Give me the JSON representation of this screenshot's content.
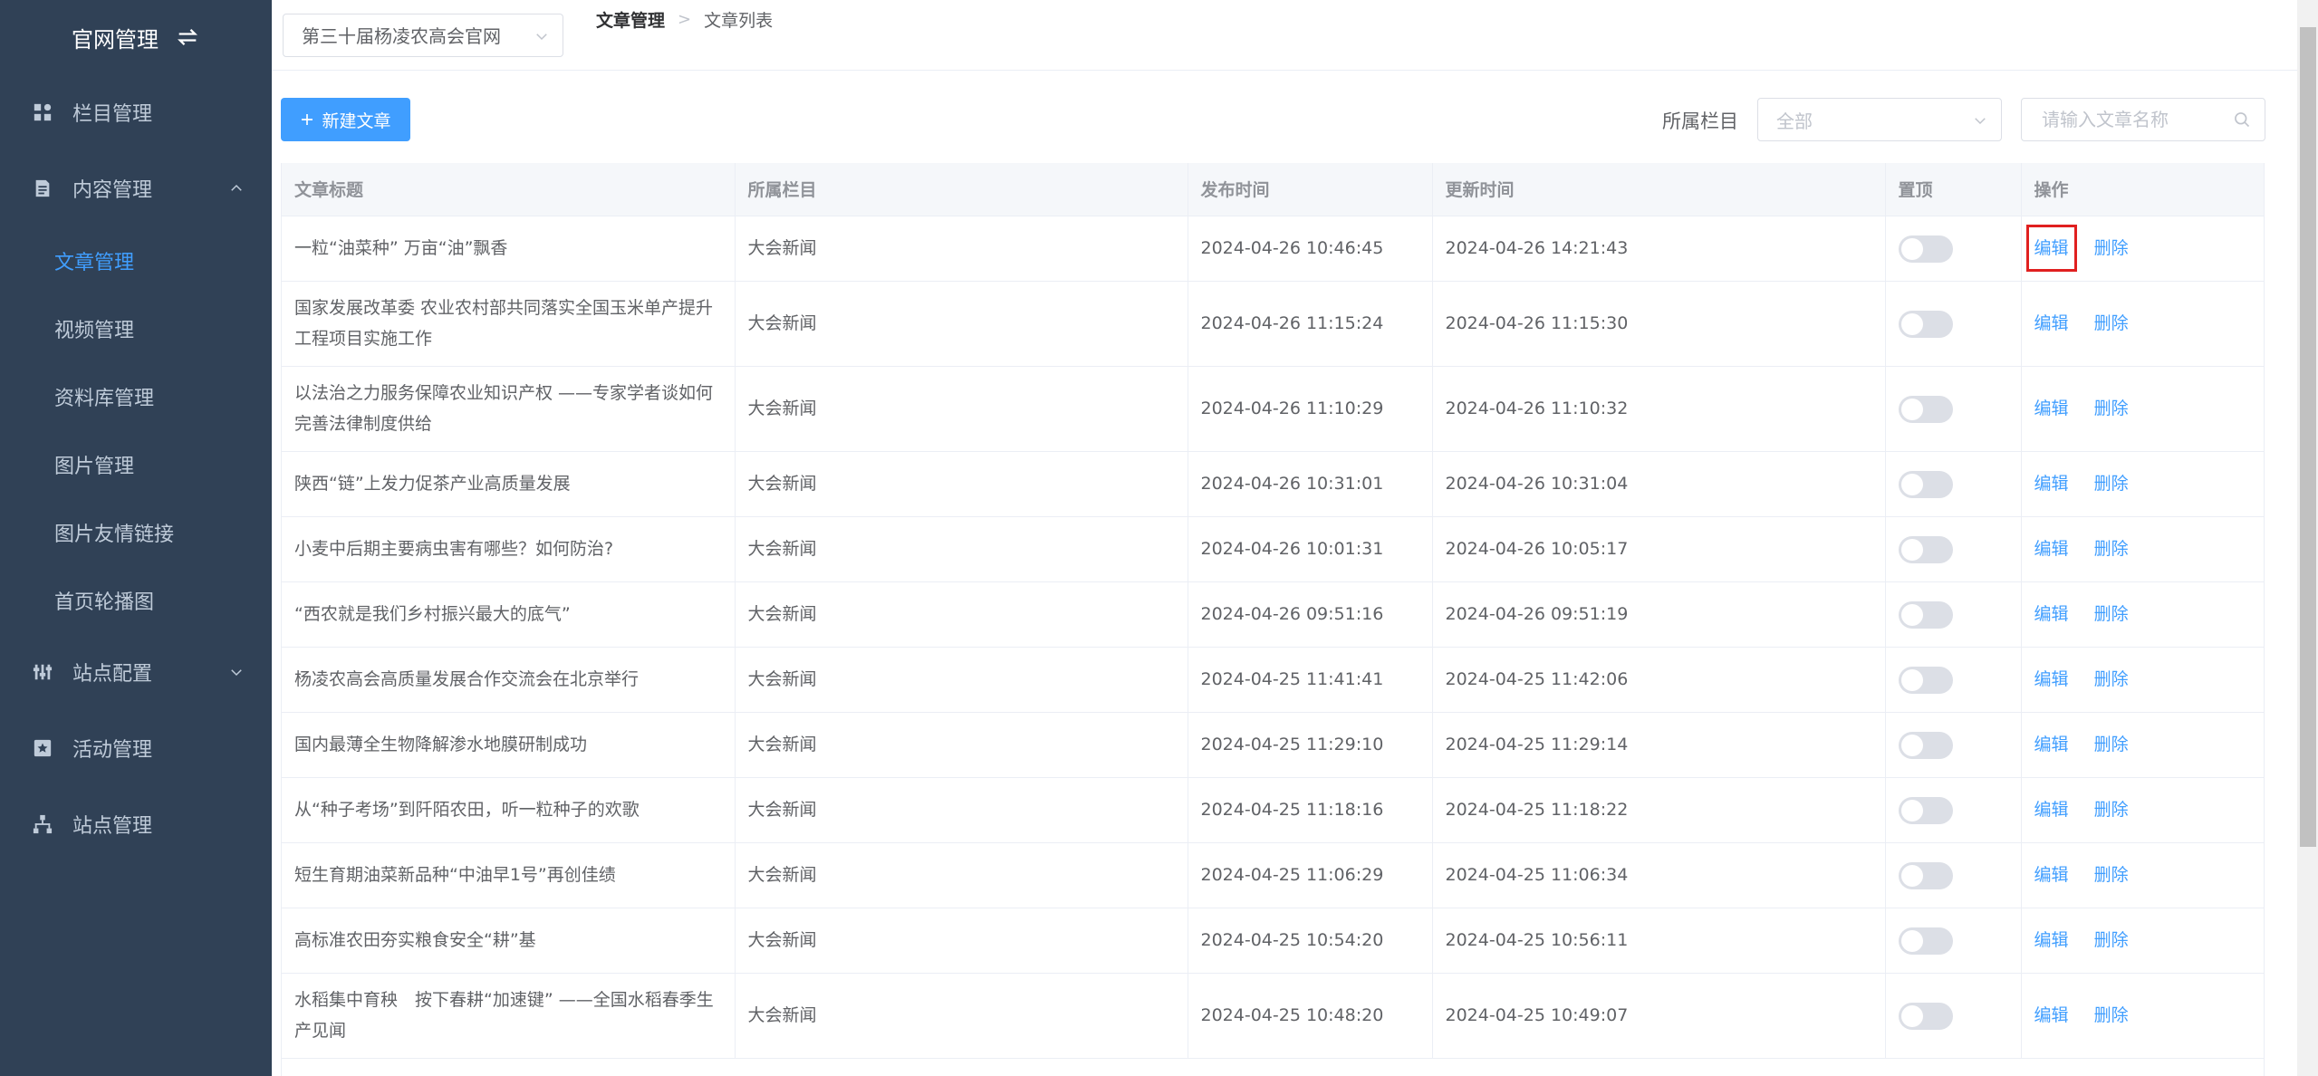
{
  "sidebar": {
    "title": "官网管理",
    "menus": [
      {
        "label": "栏目管理",
        "icon": "grid-icon"
      },
      {
        "label": "内容管理",
        "icon": "document-icon",
        "expanded": true
      },
      {
        "label": "站点配置",
        "icon": "settings-icon"
      },
      {
        "label": "活动管理",
        "icon": "star-icon"
      },
      {
        "label": "站点管理",
        "icon": "sitemap-icon"
      }
    ],
    "content_submenu": [
      "文章管理",
      "视频管理",
      "资料库管理",
      "图片管理",
      "图片友情链接",
      "首页轮播图"
    ]
  },
  "header": {
    "site_select": "第三十届杨凌农高会官网",
    "breadcrumb": [
      "文章管理",
      "文章列表"
    ]
  },
  "toolbar": {
    "new_button": "新建文章",
    "filter_label": "所属栏目",
    "filter_placeholder": "全部",
    "search_placeholder": "请输入文章名称"
  },
  "table": {
    "columns": [
      "文章标题",
      "所属栏目",
      "发布时间",
      "更新时间",
      "置顶",
      "操作"
    ],
    "edit_label": "编辑",
    "delete_label": "删除",
    "rows": [
      {
        "title": "一粒“油菜种” 万亩“油”飘香",
        "category": "大会新闻",
        "published": "2024-04-26 10:46:45",
        "updated": "2024-04-26 14:21:43",
        "pinned": false
      },
      {
        "title": "国家发展改革委 农业农村部共同落实全国玉米单产提升工程项目实施工作",
        "category": "大会新闻",
        "published": "2024-04-26 11:15:24",
        "updated": "2024-04-26 11:15:30",
        "pinned": false
      },
      {
        "title": "以法治之力服务保障农业知识产权 ——专家学者谈如何完善法律制度供给",
        "category": "大会新闻",
        "published": "2024-04-26 11:10:29",
        "updated": "2024-04-26 11:10:32",
        "pinned": false
      },
      {
        "title": "陕西“链”上发力促茶产业高质量发展",
        "category": "大会新闻",
        "published": "2024-04-26 10:31:01",
        "updated": "2024-04-26 10:31:04",
        "pinned": false
      },
      {
        "title": "小麦中后期主要病虫害有哪些？如何防治?",
        "category": "大会新闻",
        "published": "2024-04-26 10:01:31",
        "updated": "2024-04-26 10:05:17",
        "pinned": false
      },
      {
        "title": "“西农就是我们乡村振兴最大的底气”",
        "category": "大会新闻",
        "published": "2024-04-26 09:51:16",
        "updated": "2024-04-26 09:51:19",
        "pinned": false
      },
      {
        "title": "杨凌农高会高质量发展合作交流会在北京举行",
        "category": "大会新闻",
        "published": "2024-04-25 11:41:41",
        "updated": "2024-04-25 11:42:06",
        "pinned": false
      },
      {
        "title": "国内最薄全生物降解渗水地膜研制成功",
        "category": "大会新闻",
        "published": "2024-04-25 11:29:10",
        "updated": "2024-04-25 11:29:14",
        "pinned": false
      },
      {
        "title": "从“种子考场”到阡陌农田，听一粒种子的欢歌",
        "category": "大会新闻",
        "published": "2024-04-25 11:18:16",
        "updated": "2024-04-25 11:18:22",
        "pinned": false
      },
      {
        "title": "短生育期油菜新品种“中油早1号”再创佳绩",
        "category": "大会新闻",
        "published": "2024-04-25 11:06:29",
        "updated": "2024-04-25 11:06:34",
        "pinned": false
      },
      {
        "title": "高标准农田夯实粮食安全“耕”基",
        "category": "大会新闻",
        "published": "2024-04-25 10:54:20",
        "updated": "2024-04-25 10:56:11",
        "pinned": false
      },
      {
        "title": "水稻集中育秧　按下春耕“加速键” ——全国水稻春季生产见闻",
        "category": "大会新闻",
        "published": "2024-04-25 10:48:20",
        "updated": "2024-04-25 10:49:07",
        "pinned": false
      }
    ]
  }
}
